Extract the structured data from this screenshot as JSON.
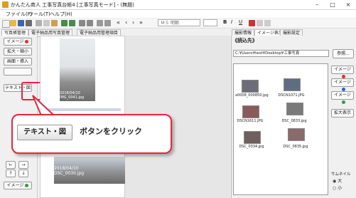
{
  "window": {
    "title": "かんたん商人 工事写真台帳4 [工事写真モード] - (無題)",
    "minimize": "–",
    "maximize": "□",
    "close": "×"
  },
  "menu": [
    "ファイル(F)",
    "ツール(T)",
    "ヘルプ(H)"
  ],
  "toolbar": {
    "font_name": "ＭＳ 明朝",
    "tools": [
      "new",
      "open",
      "save",
      "print",
      "cut",
      "copy",
      "paste",
      "undo",
      "rotate",
      "crop",
      "prev",
      "next",
      "first",
      "last",
      "zoom-in",
      "zoom-out",
      "grid",
      "list"
    ]
  },
  "tabs_left": [
    "写真帳管理",
    "電子納品用写真管理",
    "電子納品用管理項目"
  ],
  "tabs_right": [
    "撮影情報",
    "イメージ表示",
    "撮影設定"
  ],
  "left_buttons": [
    "イメージ",
    "拡大・縮小",
    "画面・挿入",
    "",
    "テキスト・図"
  ],
  "filmstrip": {
    "date1": "2018/04/10",
    "img1": "IMG_0041.jpg",
    "date2": "2018/04/10",
    "img2": "DSC_0030.jpg",
    "arrows": [
      "←",
      "→",
      "↑",
      "↓"
    ],
    "image_button": "イメージ"
  },
  "right_panel": {
    "header": "《読込先》",
    "path": "C:¥Users¥test¥Desktop¥工事写真",
    "browse": "参照...",
    "thumbnails": [
      {
        "name": "a0008_000850.jpg",
        "color": "#6b6e78"
      },
      {
        "name": "DSCN1071.JPG",
        "color": "#5f6d80"
      },
      {
        "name": "DSCN1611.JPG",
        "color": "#8a5a5a"
      },
      {
        "name": "DSC_0833.jpg",
        "color": "#7a7a7a"
      },
      {
        "name": "DSC_0334.jpg",
        "color": "#6f5f5f"
      },
      {
        "name": "DSC_0835.jpg",
        "color": "#8a6a6a"
      }
    ],
    "side_buttons": [
      {
        "label": "イメージ",
        "dot": "#e03030"
      },
      {
        "label": "イメージ",
        "dot": "#2a60c8"
      },
      {
        "label": "イメージ",
        "dot": "#2aa040"
      },
      {
        "label": "拡大表示",
        "dot": ""
      }
    ],
    "size_label": "サムネイル",
    "size_options": [
      "大",
      "小"
    ]
  },
  "callout": {
    "button_label": "テキスト・図",
    "text": "ボタンをクリック",
    "accent": "#e8243c"
  }
}
